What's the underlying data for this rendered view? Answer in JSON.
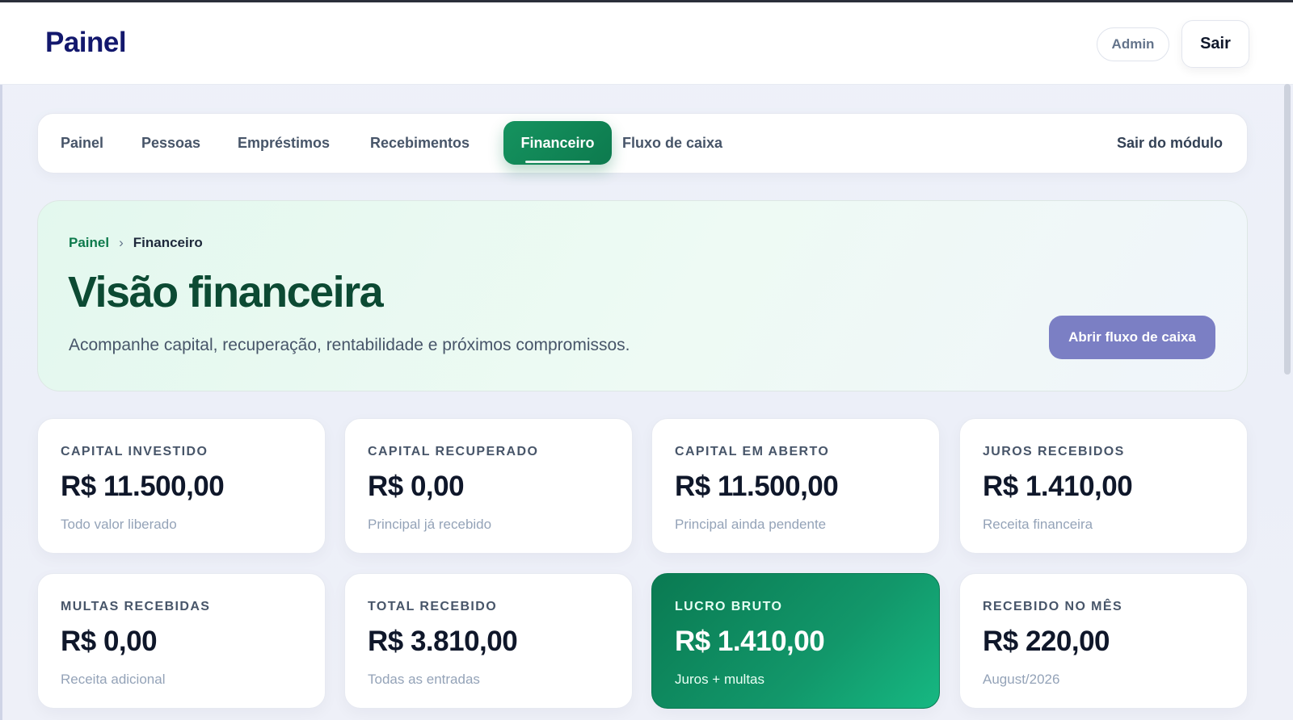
{
  "header": {
    "brand": "Painel",
    "user_badge": "Admin",
    "logout_label": "Sair"
  },
  "nav": {
    "items": [
      {
        "label": "Painel"
      },
      {
        "label": "Pessoas"
      },
      {
        "label": "Empréstimos"
      },
      {
        "label": "Recebimentos"
      },
      {
        "label": "Financeiro",
        "active": true
      },
      {
        "label": "Fluxo de caixa"
      }
    ],
    "exit_label": "Sair do módulo"
  },
  "hero": {
    "breadcrumb": {
      "root": "Painel",
      "separator": "›",
      "current": "Financeiro"
    },
    "title": "Visão financeira",
    "subtitle": "Acompanhe capital, recuperação, rentabilidade e próximos compromissos.",
    "action_label": "Abrir fluxo de caixa"
  },
  "cards": [
    {
      "label": "CAPITAL INVESTIDO",
      "value": "R$ 11.500,00",
      "note": "Todo valor liberado"
    },
    {
      "label": "CAPITAL RECUPERADO",
      "value": "R$ 0,00",
      "note": "Principal já recebido"
    },
    {
      "label": "CAPITAL EM ABERTO",
      "value": "R$ 11.500,00",
      "note": "Principal ainda pendente"
    },
    {
      "label": "JUROS RECEBIDOS",
      "value": "R$ 1.410,00",
      "note": "Receita financeira"
    },
    {
      "label": "MULTAS RECEBIDAS",
      "value": "R$ 0,00",
      "note": "Receita adicional"
    },
    {
      "label": "TOTAL RECEBIDO",
      "value": "R$ 3.810,00",
      "note": "Todas as entradas"
    },
    {
      "label": "LUCRO BRUTO",
      "value": "R$ 1.410,00",
      "note": "Juros + multas",
      "highlight": true
    },
    {
      "label": "RECEBIDO NO MÊS",
      "value": "R$ 220,00",
      "note": "August/2026"
    }
  ],
  "colors": {
    "brand": "#13186d",
    "accent_green": "#0d7a4e",
    "hero_button": "#7b7fc4"
  }
}
